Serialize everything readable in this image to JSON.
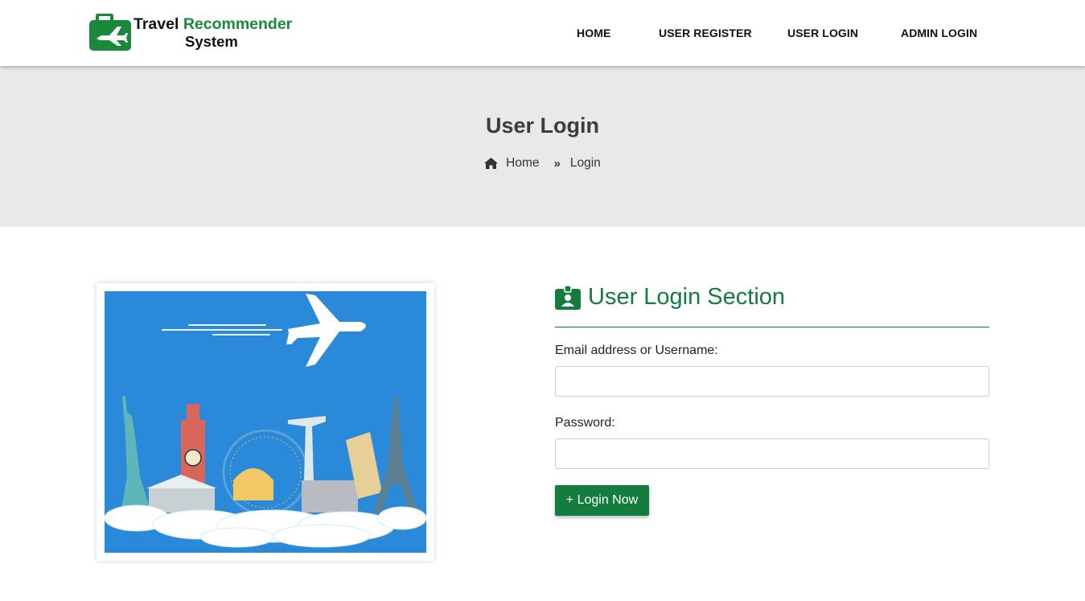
{
  "brand": {
    "line1_word1": "Travel",
    "line1_word2": "Recommender",
    "line2": "System",
    "accent": "#1a8a3a",
    "icon": "suitcase-plane-icon"
  },
  "nav": {
    "items": [
      {
        "label": "HOME"
      },
      {
        "label": "USER REGISTER"
      },
      {
        "label": "USER LOGIN"
      },
      {
        "label": "ADMIN LOGIN"
      }
    ]
  },
  "banner": {
    "title": "User Login",
    "breadcrumb": {
      "home": "Home",
      "current": "Login",
      "home_icon": "home-icon",
      "separator_icon": "double-chevron-right-icon"
    }
  },
  "hero_image": {
    "description_icon": "travel-landmarks-illustration"
  },
  "login": {
    "title": "User Login Section",
    "title_icon": "id-badge-icon",
    "email_label": "Email address or Username:",
    "email_value": "",
    "password_label": "Password:",
    "password_value": "",
    "submit_label": "+ Login Now"
  },
  "colors": {
    "primary": "#137c3e",
    "banner_bg": "#e9e9e9",
    "image_bg": "#2a8ad9"
  }
}
